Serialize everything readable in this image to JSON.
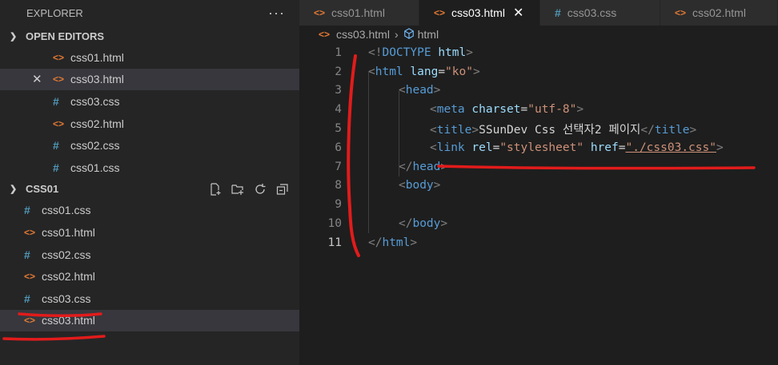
{
  "explorer": {
    "title": "EXPLORER",
    "more": "···",
    "open_editors_label": "OPEN EDITORS",
    "open_editors": [
      {
        "name": "css01.html",
        "type": "html"
      },
      {
        "name": "css03.html",
        "type": "html"
      },
      {
        "name": "css03.css",
        "type": "css"
      },
      {
        "name": "css02.html",
        "type": "html"
      },
      {
        "name": "css02.css",
        "type": "css"
      },
      {
        "name": "css01.css",
        "type": "css"
      }
    ],
    "workspace_label": "CSS01",
    "workspace_files": [
      {
        "name": "css01.css",
        "type": "css"
      },
      {
        "name": "css01.html",
        "type": "html"
      },
      {
        "name": "css02.css",
        "type": "css"
      },
      {
        "name": "css02.html",
        "type": "html"
      },
      {
        "name": "css03.css",
        "type": "css"
      },
      {
        "name": "css03.html",
        "type": "html"
      }
    ]
  },
  "tabs": [
    {
      "label": "css01.html",
      "type": "html"
    },
    {
      "label": "css03.html",
      "type": "html"
    },
    {
      "label": "css03.css",
      "type": "css"
    },
    {
      "label": "css02.html",
      "type": "html"
    }
  ],
  "breadcrumb": {
    "file": "css03.html",
    "symbol": "html"
  },
  "code": {
    "line_numbers": [
      "1",
      "2",
      "3",
      "4",
      "5",
      "6",
      "7",
      "8",
      "9",
      "10",
      "11"
    ],
    "l1": {
      "open": "<!",
      "kw": "DOCTYPE",
      "sp": " ",
      "val": "html",
      "close": ">"
    },
    "l2": {
      "open": "<",
      "tag": "html",
      "sp": " ",
      "attr": "lang",
      "eq": "=",
      "val": "\"ko\"",
      "close": ">"
    },
    "l3": {
      "open": "<",
      "tag": "head",
      "close": ">"
    },
    "l4": {
      "open": "<",
      "tag": "meta",
      "sp": " ",
      "attr": "charset",
      "eq": "=",
      "val": "\"utf-8\"",
      "close": ">"
    },
    "l5": {
      "open": "<",
      "tag": "title",
      "close": ">",
      "text": "SSunDev Css 선택자2 페이지",
      "open2": "</",
      "tag2": "title",
      "close2": ">"
    },
    "l6": {
      "open": "<",
      "tag": "link",
      "sp1": " ",
      "attr1": "rel",
      "eq1": "=",
      "val1": "\"stylesheet\"",
      "sp2": " ",
      "attr2": "href",
      "eq2": "=",
      "val2": "\"./css03.css\"",
      "close": ">"
    },
    "l7": {
      "open": "</",
      "tag": "head",
      "close": ">"
    },
    "l8": {
      "open": "<",
      "tag": "body",
      "close": ">"
    },
    "l10": {
      "open": "</",
      "tag": "body",
      "close": ">"
    },
    "l11": {
      "open": "</",
      "tag": "html",
      "close": ">"
    }
  },
  "colors": {
    "annotation": "#e21b1b",
    "html_icon": "#e37933",
    "css_icon": "#519aba"
  },
  "icons": [
    "new-file-icon",
    "new-folder-icon",
    "refresh-icon",
    "collapse-all-icon",
    "cube-icon"
  ]
}
